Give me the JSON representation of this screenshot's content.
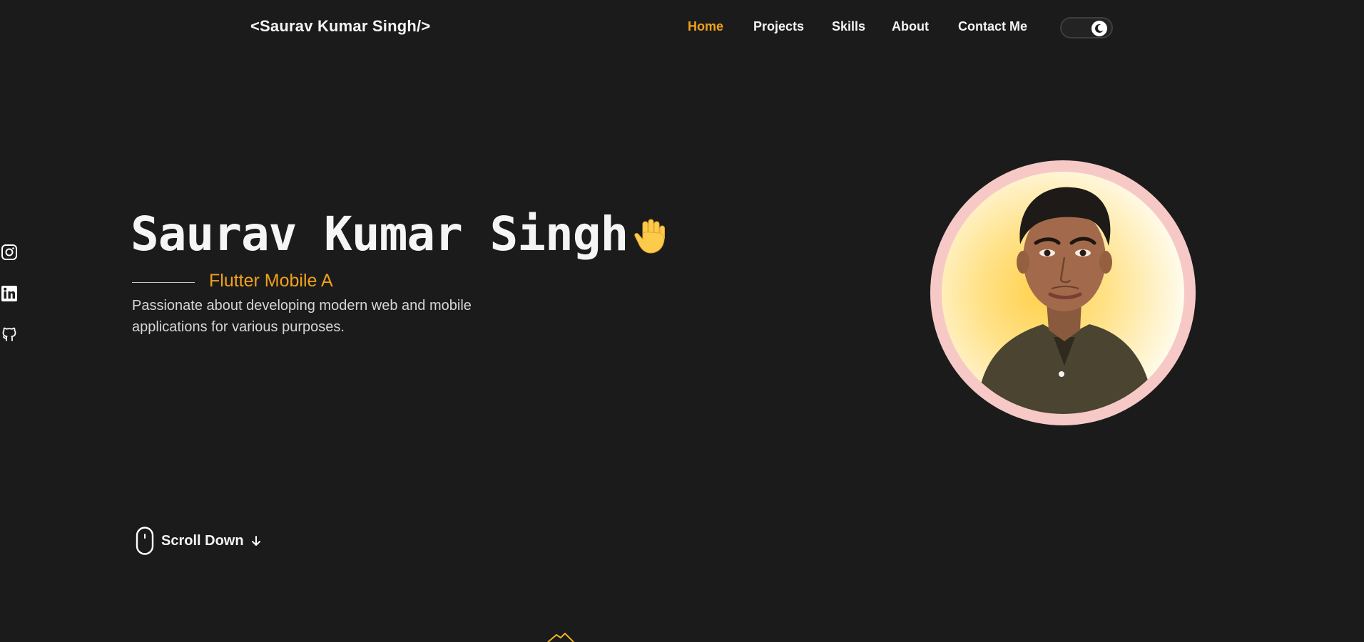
{
  "header": {
    "logo": "<Saurav Kumar Singh/>",
    "nav": [
      {
        "label": "Home",
        "active": true
      },
      {
        "label": "Projects",
        "active": false
      },
      {
        "label": "Skills",
        "active": false
      },
      {
        "label": "About",
        "active": false
      },
      {
        "label": "Contact Me",
        "active": false
      }
    ],
    "theme_toggle_icon": "moon-icon"
  },
  "social": [
    {
      "icon": "instagram-icon"
    },
    {
      "icon": "linkedin-icon"
    },
    {
      "icon": "github-icon"
    }
  ],
  "hero": {
    "name": "Saurav Kumar Singh",
    "emoji": "waving-hand-icon",
    "role": "Flutter Mobile A",
    "description": "Passionate about developing modern web and mobile applications for various purposes."
  },
  "scroll": {
    "label": "Scroll Down",
    "icon": "arrow-down-icon"
  },
  "colors": {
    "background": "#1b1b1c",
    "accent": "#f0a11b",
    "text": "#f4f4f4",
    "avatar_ring": "#f7c9c6"
  }
}
